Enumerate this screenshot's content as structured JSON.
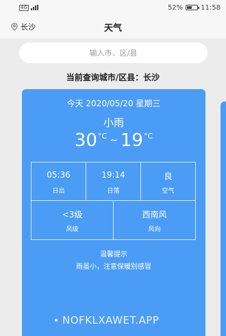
{
  "status_bar": {
    "network_badge": "4G",
    "battery_percent": "52%",
    "battery_level": 0.52,
    "time": "11:58"
  },
  "header": {
    "location_icon": "location-pin-icon",
    "location": "长沙",
    "title": "天气"
  },
  "search": {
    "placeholder": "输入市、区/县"
  },
  "query": {
    "text": "当前查询城市/区县：长沙"
  },
  "weather": {
    "date_line": "今天 2020/05/20 星期三",
    "condition": "小雨",
    "temp_high": "30",
    "temp_low": "19",
    "temp_unit": "°C",
    "temp_separator": "~",
    "details": {
      "sunrise": {
        "value": "05:36",
        "label": "日出"
      },
      "sunset": {
        "value": "19:14",
        "label": "日落"
      },
      "air": {
        "value": "良",
        "label": "空气"
      },
      "wind_level": {
        "value": "<3级",
        "label": "风级"
      },
      "wind_dir": {
        "value": "西南风",
        "label": "风向"
      }
    },
    "tip_title": "温馨提示",
    "tip_text": "雨虽小，注意保暖别感冒"
  },
  "watermark": {
    "text": "NOFKLXAWET.APP"
  },
  "colors": {
    "card": "#4a9cf5",
    "background": "#ececec",
    "header": "#f7f7f7"
  }
}
